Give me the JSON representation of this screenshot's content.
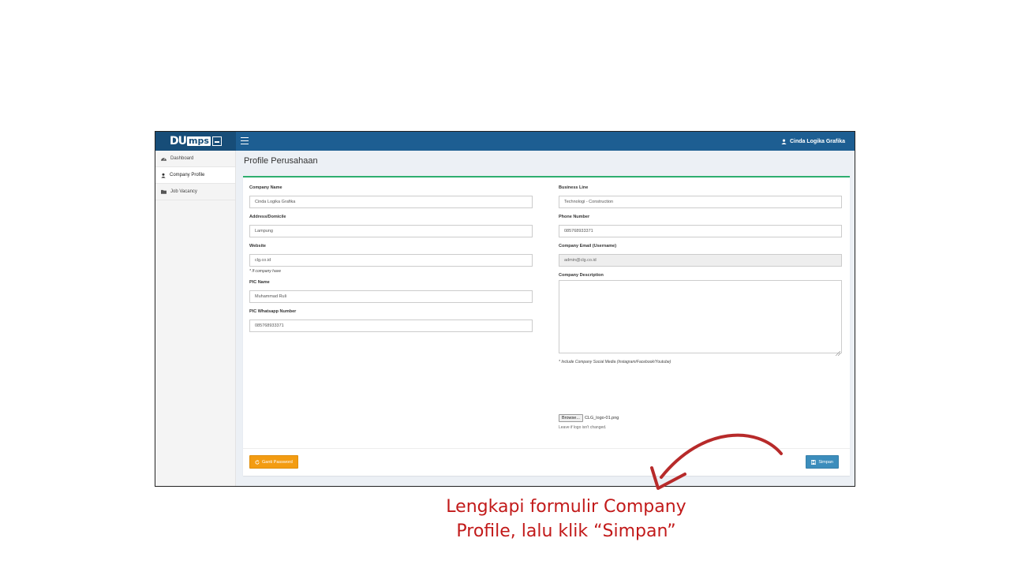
{
  "app": {
    "logo_text_main": "DU",
    "logo_text_box": "mps"
  },
  "topbar": {
    "user_name": "Cinda Logika Grafika",
    "bar_color": "#1d5e92"
  },
  "sidebar": {
    "items": [
      {
        "label": "Dashboard",
        "icon": "dashboard-icon"
      },
      {
        "label": "Company Profile",
        "icon": "user-icon",
        "active": true
      },
      {
        "label": "Job Vacancy",
        "icon": "folder-icon"
      }
    ]
  },
  "page": {
    "title": "Profile Perusahaan"
  },
  "form": {
    "company_name": {
      "label": "Company Name",
      "value": "Cinda Logika Grafika"
    },
    "address": {
      "label": "Address/Domicile",
      "value": "Lampung"
    },
    "website": {
      "label": "Website",
      "value": "clg.co.id",
      "help": "* If company have"
    },
    "pic_name": {
      "label": "PIC Name",
      "value": "Muhammad Ruli"
    },
    "pic_whatsapp": {
      "label": "PIC Whatsapp Number",
      "value": "085768933371"
    },
    "business_line": {
      "label": "Business Line",
      "value": "Technologi - Construction"
    },
    "phone": {
      "label": "Phone Number",
      "value": "085768933371"
    },
    "email": {
      "label": "Company Email (Username)",
      "value": "admin@clg.co.id"
    },
    "description": {
      "label": "Company Description",
      "value": "",
      "help": "* Include Company Social Media (Instagram/Facebook/Youtube)"
    },
    "logo": {
      "browse_label": "Browse...",
      "file_name": "CLG_logo-01.png",
      "help": "Leave if logo isn't changed."
    }
  },
  "footer": {
    "change_password_label": "Ganti Password",
    "save_label": "Simpan",
    "change_password_color": "#f39c12",
    "save_color": "#3c8dbc"
  },
  "annotation": {
    "line1": "Lengkapi formulir Company",
    "line2": "Profile, lalu klik “Simpan”",
    "color": "#c21a1a"
  }
}
